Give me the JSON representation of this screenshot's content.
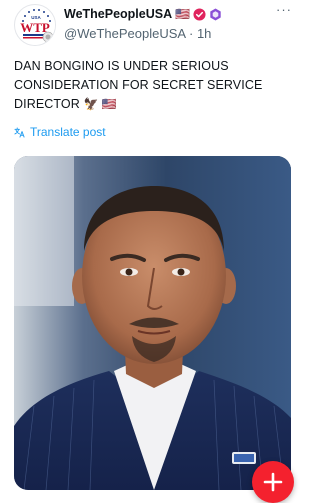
{
  "author": {
    "display_name": "WeThePeopleUSA",
    "handle": "@WeThePeopleUSA",
    "separator": "·",
    "time": "1h",
    "avatar_text": "WTP",
    "avatar_small_text": "USA",
    "flag_emoji": "🇺🇸",
    "badges": [
      "flag-icon",
      "verified-red-icon",
      "purple-hexagon-icon"
    ]
  },
  "post": {
    "line1": "DAN BONGINO IS UNDER SERIOUS",
    "line2": "CONSIDERATION FOR SECRET SERVICE",
    "line3": "DIRECTOR",
    "emojis": "🦅 🇺🇸"
  },
  "translate": {
    "label": "Translate post"
  },
  "media": {
    "description_icon": "portrait-photo"
  },
  "fab": {
    "icon": "plus-icon"
  },
  "more": {
    "icon": "more-dots-icon",
    "text": "···"
  },
  "colors": {
    "accent_blue": "#1d9bf0",
    "fab_red": "#f4212e",
    "muted": "#536471",
    "verified_red": "#e0245e",
    "hexagon_purple": "#8a4fd6"
  }
}
